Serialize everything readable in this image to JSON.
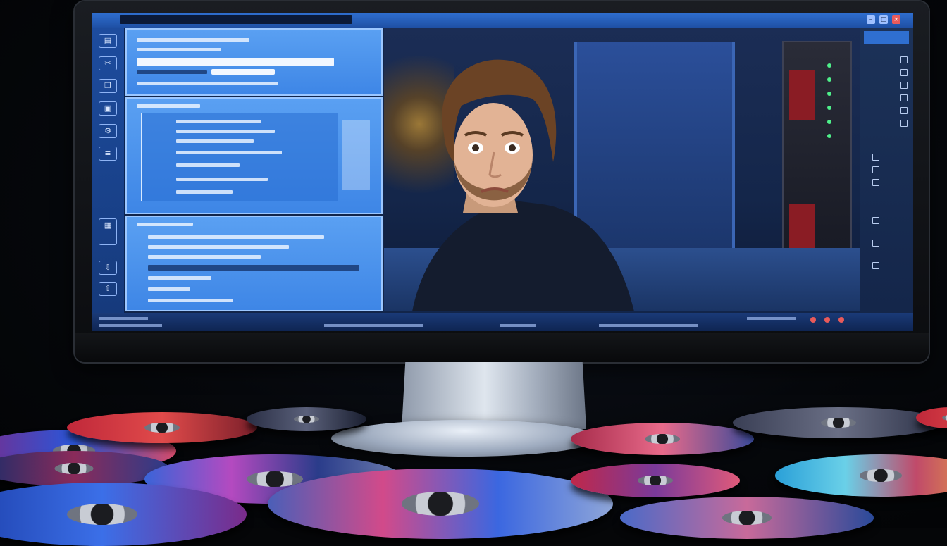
{
  "image": {
    "kind": "photo-illustration",
    "subject": "monitor showing video editing interface with surprised man, surrounded by optical discs"
  },
  "colors": {
    "screen_blue": "#3e86e6",
    "panel_border": "#9cc7ff",
    "toolbar_blue": "#1d4c9e",
    "background": "#050608",
    "disc_red": "#c0283a",
    "disc_blue": "#2a56d8"
  },
  "icons": {
    "window_controls": [
      "minimize-icon",
      "maximize-icon",
      "close-icon"
    ],
    "toolbar": [
      "folder-icon",
      "cut-icon",
      "copy-icon",
      "paste-icon",
      "settings-icon",
      "film-icon",
      "export-icon"
    ]
  }
}
